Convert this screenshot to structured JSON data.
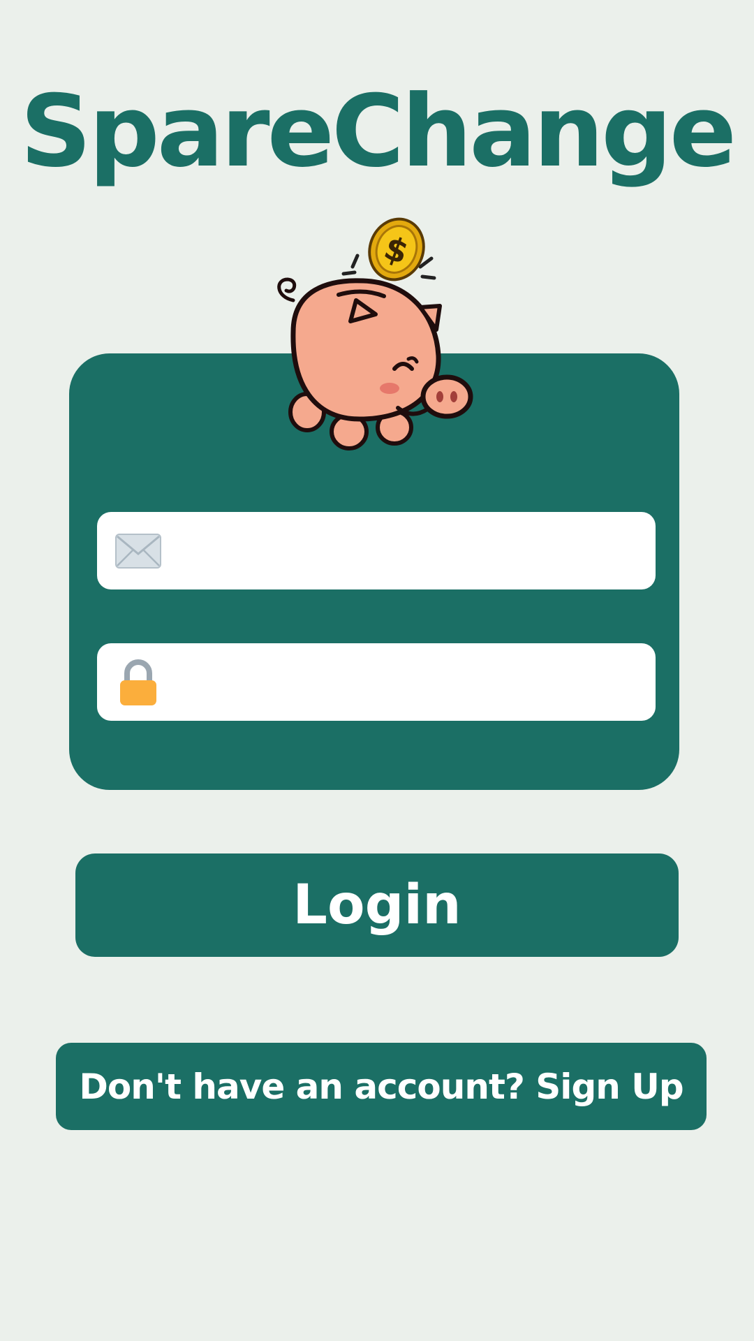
{
  "app": {
    "title": "SpareChange"
  },
  "login_form": {
    "email": {
      "icon": "envelope-icon",
      "value": "",
      "placeholder": ""
    },
    "password": {
      "icon": "lock-icon",
      "value": "",
      "placeholder": ""
    },
    "login_label": "Login"
  },
  "signup": {
    "label": "Don't have an account? Sign Up"
  },
  "mascot": {
    "icon": "piggy-bank-with-coin-icon"
  },
  "colors": {
    "background": "#ebf0eb",
    "brand": "#1b6f65",
    "field": "#ffffff",
    "lock": "#fbae3c",
    "envelope": "#d8e0e6",
    "pig": "#f5a98e",
    "coin": "#f1c40f"
  }
}
